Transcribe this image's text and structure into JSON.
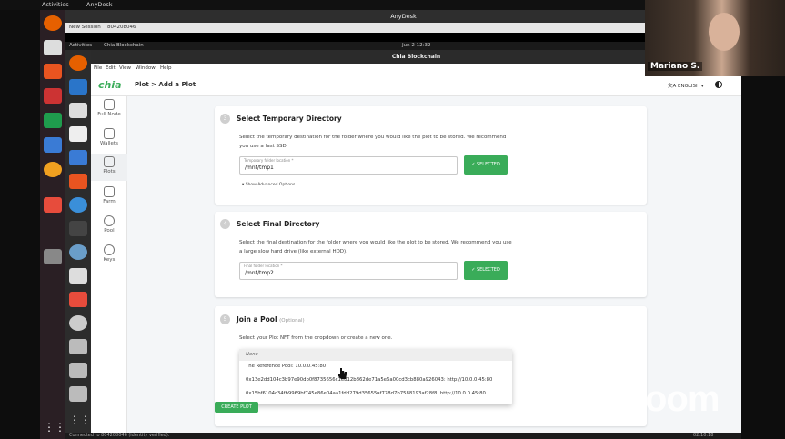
{
  "outer": {
    "activities": "Activities",
    "app_name": "AnyDesk",
    "anydesk_title": "AnyDesk",
    "tab_label": "New Session",
    "session_id": "804208046",
    "status_text": "Connected to 804208046 (identity verified).",
    "clock": "02:10:18"
  },
  "remote": {
    "activities": "Activities",
    "app_menu": "Chia Blockchain",
    "clock": "Jun 2  12:32",
    "window_title": "Chia Blockchain",
    "menu": [
      "File",
      "Edit",
      "View",
      "Window",
      "Help"
    ]
  },
  "header": {
    "logo": "chia",
    "breadcrumb": "Plot > Add a Plot",
    "language": "ENGLISH"
  },
  "sidebar": {
    "items": [
      {
        "label": "Full Node",
        "icon": "home-icon"
      },
      {
        "label": "Wallets",
        "icon": "wallet-icon"
      },
      {
        "label": "Plots",
        "icon": "plots-icon"
      },
      {
        "label": "Farm",
        "icon": "farm-icon"
      },
      {
        "label": "Pool",
        "icon": "pool-icon"
      },
      {
        "label": "Keys",
        "icon": "keys-icon"
      }
    ]
  },
  "step3": {
    "number": "3",
    "title": "Select Temporary Directory",
    "desc": "Select the temporary destination for the folder where you would like the plot to be stored. We recommend you use a fast SSD.",
    "field_label": "Temporary folder location *",
    "field_value": "/mnt/tmp1",
    "button": "SELECTED",
    "advanced": "Show Advanced Options"
  },
  "step4": {
    "number": "4",
    "title": "Select Final Directory",
    "desc": "Select the final destination for the folder where you would like the plot to be stored. We recommend you use a large slow hard drive (like external HDD).",
    "field_label": "Final folder location *",
    "field_value": "/mnt/tmp2",
    "button": "SELECTED"
  },
  "step5": {
    "number": "5",
    "title": "Join a Pool",
    "optional": "(Optional)",
    "desc": "Select your Plot NFT from the dropdown or create a new one."
  },
  "dropdown": {
    "options": [
      "None",
      "The Reference Pool: 10.0.0.45:80",
      "0x13e2dd104c3b97e90db0f8735656c1e812b862de71a5e6a00cd3cb880a926043: http://10.0.0.45:80",
      "0x15bf6104c34fb9969bf745e86e04aa1fdd279d35655af778d7b7588193af28f8: http://10.0.0.45:80"
    ]
  },
  "actions": {
    "create_plot": "CREATE PLOT"
  },
  "webcam": {
    "name": "Mariano S."
  },
  "watermark": "zoom",
  "colors": {
    "accent": "#3aac59"
  }
}
